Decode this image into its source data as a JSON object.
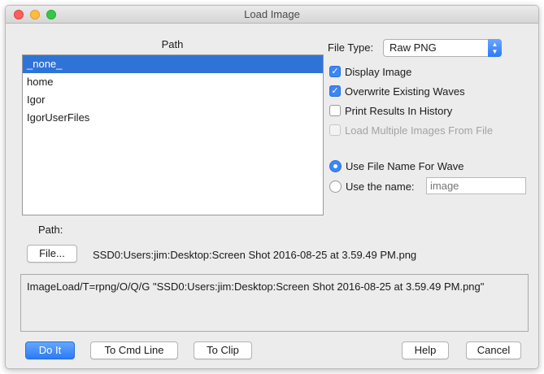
{
  "window": {
    "title": "Load Image"
  },
  "path_list": {
    "header": "Path",
    "items": [
      {
        "label": "_none_",
        "selected": true
      },
      {
        "label": "home",
        "selected": false
      },
      {
        "label": "Igor",
        "selected": false
      },
      {
        "label": "IgorUserFiles",
        "selected": false
      }
    ]
  },
  "file_type": {
    "label": "File Type:",
    "value": "Raw PNG"
  },
  "options": {
    "display_image": "Display Image",
    "overwrite": "Overwrite Existing Waves",
    "print_results": "Print Results In History",
    "load_multiple": "Load Multiple Images From File"
  },
  "naming": {
    "use_file_name": "Use File Name For Wave",
    "use_the_name": "Use the name:",
    "name_placeholder": "image"
  },
  "path_label": "Path:",
  "file_button": "File...",
  "file_path": "SSD0:Users:jim:Desktop:Screen Shot 2016-08-25 at 3.59.49 PM.png",
  "command": "ImageLoad/T=rpng/O/Q/G \"SSD0:Users:jim:Desktop:Screen Shot 2016-08-25 at 3.59.49 PM.png\"",
  "buttons": {
    "do_it": "Do It",
    "to_cmd_line": "To Cmd Line",
    "to_clip": "To Clip",
    "help": "Help",
    "cancel": "Cancel"
  },
  "colors": {
    "accent": "#2f73d9"
  }
}
